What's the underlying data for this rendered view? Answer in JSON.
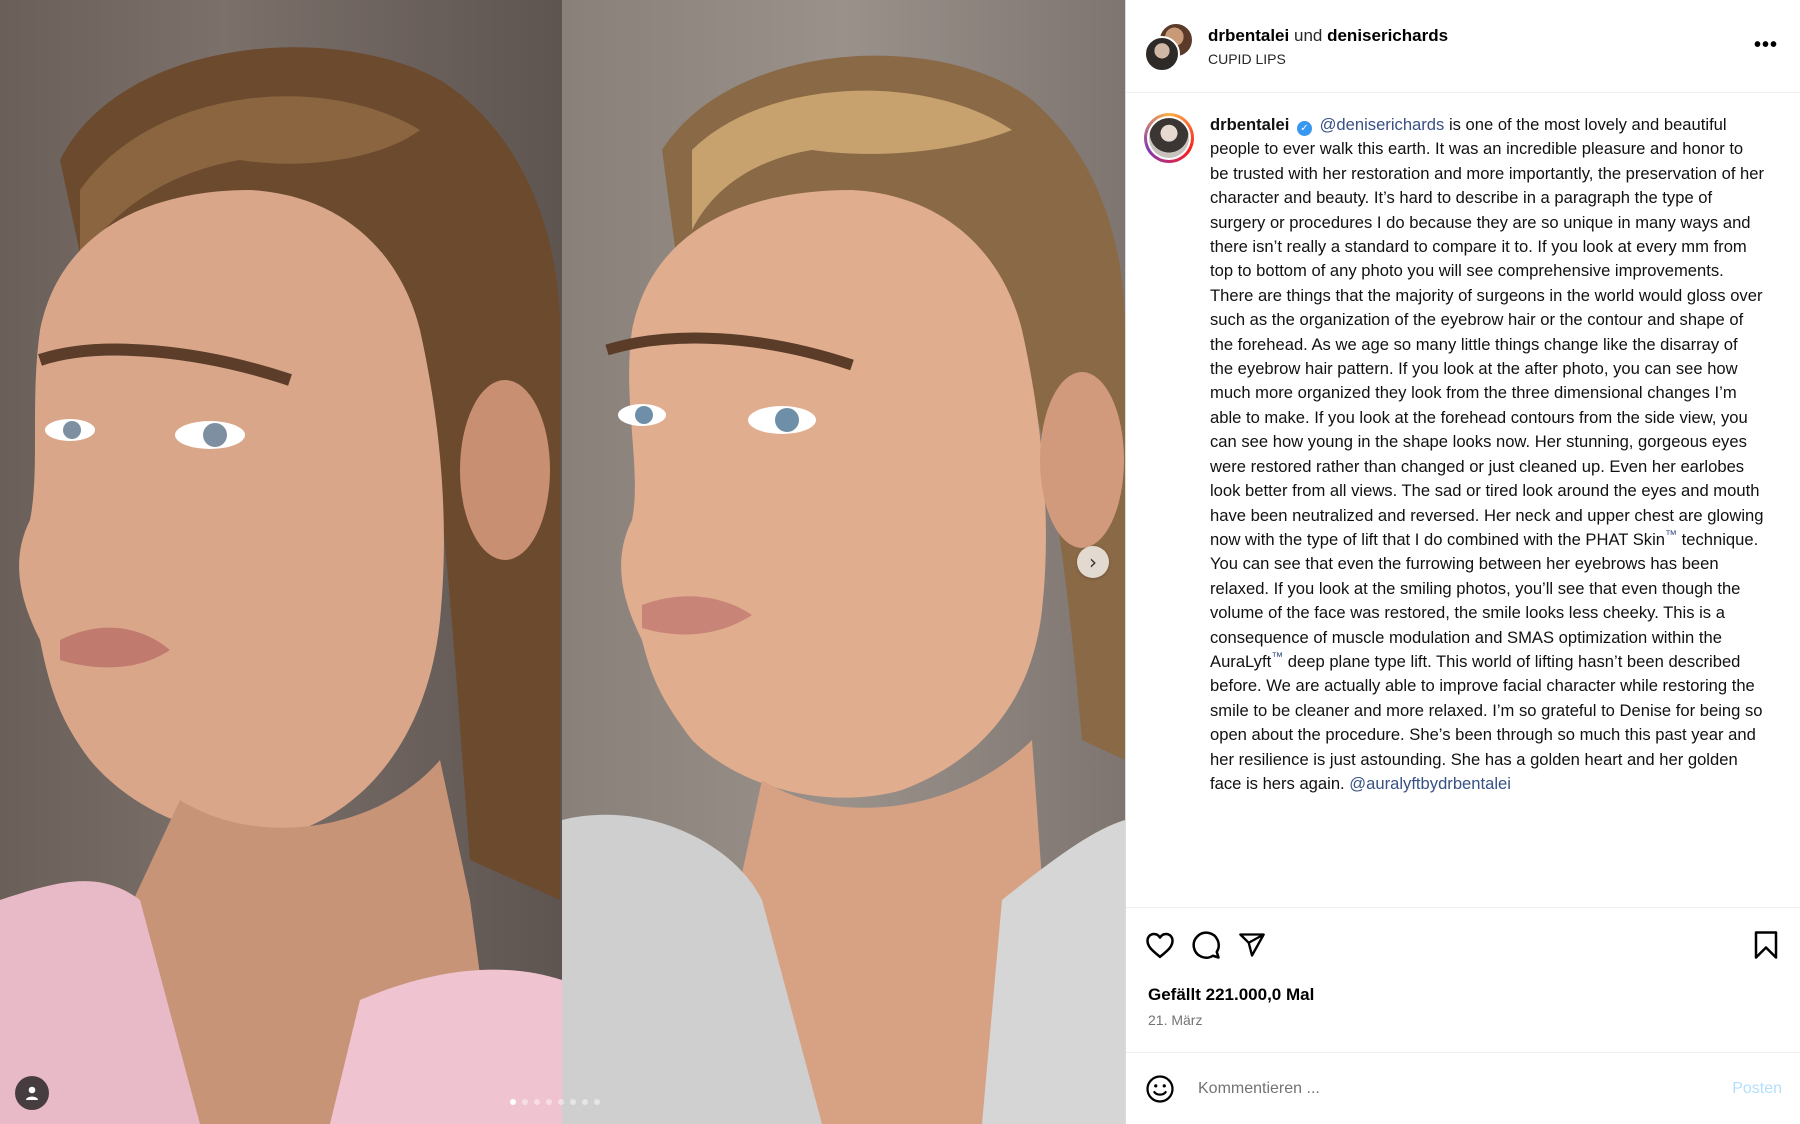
{
  "media": {
    "carousel_count": 8,
    "active_index": 0,
    "next_icon": "chevron-right-icon",
    "tag_icon": "user-tag-icon"
  },
  "header": {
    "user1": "drbentalei",
    "connector": "und",
    "user2": "deniserichards",
    "subtitle": "CUPID LIPS",
    "more_icon": "more-options-icon"
  },
  "caption": {
    "author": "drbentalei",
    "mention_denise": "@deniserichards",
    "part1": " is one of the most lovely and beautiful people to ever walk this earth. It was an incredible pleasure and honor to be trusted with her restoration and more importantly, the preservation of her character and beauty. It’s hard to describe in a paragraph the type of surgery or procedures I do because they are so unique in many ways and there isn’t really a standard to compare it to. If you look at every mm from top to bottom of any photo you will see comprehensive improvements. There are things that the majority of surgeons in the world would gloss over such as the organization of the eyebrow hair or the contour and shape of the forehead. As we age so many little things change like the disarray of the eyebrow hair pattern. If you look at the after photo, you can see how much more organized they look from the three dimensional changes I’m able to make. If you look at the forehead contours from the side view, you can see how young in the shape looks now. Her stunning, gorgeous eyes were restored rather than changed or just cleaned up. Even her earlobes look better from all views. The sad or tired look around the eyes and mouth have been neutralized and reversed. Her neck and upper chest are glowing now with the type of lift that I do combined with the PHAT Skin",
    "tm1": "™",
    "part2": "  technique. You can see that even the furrowing between her eyebrows has been relaxed. If you look at the smiling photos, you’ll see that even though the volume of the face was restored, the smile looks less cheeky. This is a consequence of muscle modulation and SMAS optimization within the AuraLyft",
    "tm2": "™",
    "part3": "  deep plane type lift. This world of lifting hasn’t been described before. We are actually able to improve facial character while restoring the smile to be cleaner and more relaxed. I’m so grateful to Denise for being so open about the procedure. She’s been through so much this past year and her resilience is just astounding. She has a golden heart and her golden face is hers again. ",
    "mention_auralyft": "@auralyftbydrbentalei"
  },
  "actions": {
    "like_icon": "heart-icon",
    "comment_icon": "comment-icon",
    "share_icon": "share-icon",
    "save_icon": "bookmark-icon"
  },
  "likes_text": "Gefällt 221.000,0 Mal",
  "date_text": "21. März",
  "comment": {
    "emoji_icon": "emoji-icon",
    "placeholder": "Kommentieren ...",
    "post_label": "Posten"
  },
  "colors": {
    "link": "#385185",
    "verified": "#3897f0",
    "post_disabled": "#b2dffc"
  }
}
